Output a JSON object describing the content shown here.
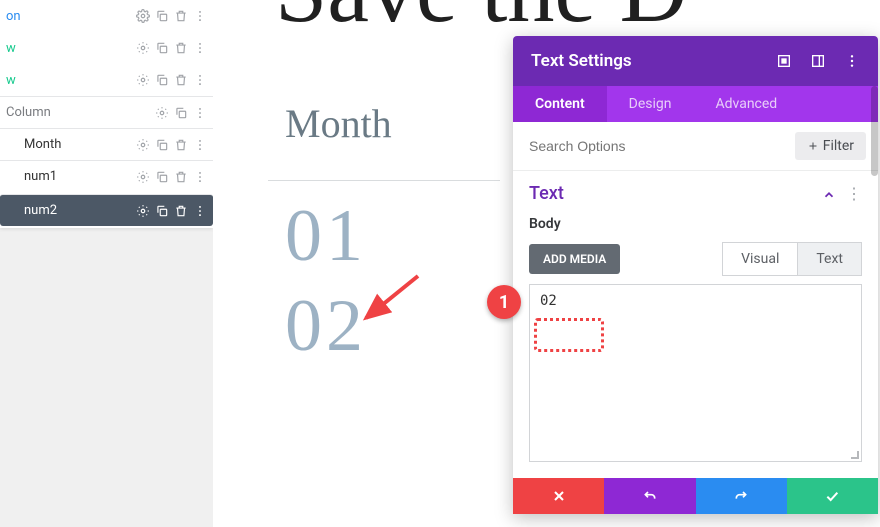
{
  "layers": {
    "items": [
      {
        "label": "on",
        "kind": "section"
      },
      {
        "label": "w",
        "kind": "row"
      },
      {
        "label": "w",
        "kind": "row"
      },
      {
        "label": "Column",
        "kind": "col"
      },
      {
        "label": "Month",
        "kind": "mod"
      },
      {
        "label": "num1",
        "kind": "mod"
      },
      {
        "label": "num2",
        "kind": "mod",
        "active": true
      }
    ]
  },
  "preview": {
    "big_title": "Save the D",
    "month_label": "Month",
    "num1": "01",
    "num2": "02"
  },
  "panel": {
    "title": "Text Settings",
    "tabs": {
      "content": "Content",
      "design": "Design",
      "advanced": "Advanced"
    },
    "search_placeholder": "Search Options",
    "filter_label": "Filter",
    "section": "Text",
    "body_label": "Body",
    "add_media": "ADD MEDIA",
    "mode_visual": "Visual",
    "mode_text": "Text",
    "textarea_value": "02"
  },
  "annotation": {
    "badge": "1"
  }
}
